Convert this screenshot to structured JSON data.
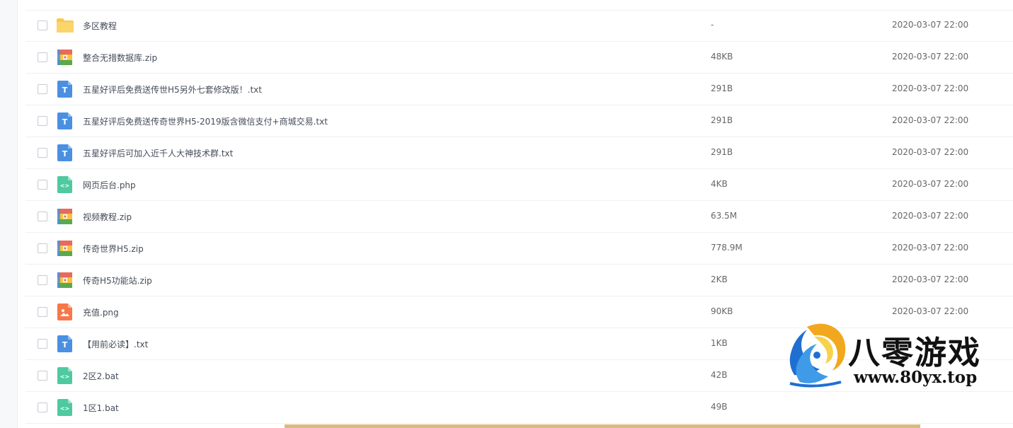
{
  "files": [
    {
      "name": "多区教程",
      "size": "-",
      "date": "2020-03-07 22:00",
      "type": "folder",
      "icon": "folder-icon"
    },
    {
      "name": "整合无措数据库.zip",
      "size": "48KB",
      "date": "2020-03-07 22:00",
      "type": "zip",
      "icon": "zip-icon"
    },
    {
      "name": "五星好评后免费送传世H5另外七套修改版！.txt",
      "size": "291B",
      "date": "2020-03-07 22:00",
      "type": "txt",
      "icon": "text-file-icon"
    },
    {
      "name": "五星好评后免费送传奇世界H5-2019版含微信支付+商城交易.txt",
      "size": "291B",
      "date": "2020-03-07 22:00",
      "type": "txt",
      "icon": "text-file-icon"
    },
    {
      "name": "五星好评后可加入近千人大神技术群.txt",
      "size": "291B",
      "date": "2020-03-07 22:00",
      "type": "txt",
      "icon": "text-file-icon"
    },
    {
      "name": "网页后台.php",
      "size": "4KB",
      "date": "2020-03-07 22:00",
      "type": "code",
      "icon": "code-file-icon"
    },
    {
      "name": "视频教程.zip",
      "size": "63.5M",
      "date": "2020-03-07 22:00",
      "type": "zip",
      "icon": "zip-icon"
    },
    {
      "name": "传奇世界H5.zip",
      "size": "778.9M",
      "date": "2020-03-07 22:00",
      "type": "zip",
      "icon": "zip-icon"
    },
    {
      "name": "传奇H5功能站.zip",
      "size": "2KB",
      "date": "2020-03-07 22:00",
      "type": "zip",
      "icon": "zip-icon"
    },
    {
      "name": "充值.png",
      "size": "90KB",
      "date": "2020-03-07 22:00",
      "type": "image",
      "icon": "image-file-icon"
    },
    {
      "name": "【用前必读】.txt",
      "size": "1KB",
      "date": "",
      "type": "txt",
      "icon": "text-file-icon"
    },
    {
      "name": "2区2.bat",
      "size": "42B",
      "date": "",
      "type": "code",
      "icon": "code-file-icon"
    },
    {
      "name": "1区1.bat",
      "size": "49B",
      "date": "",
      "type": "code",
      "icon": "code-file-icon"
    }
  ],
  "watermark": {
    "title": "八零游戏",
    "url": "www.80yx.top"
  },
  "colors": {
    "folder": "#f9c74f",
    "txt": "#4a90e2",
    "code": "#4ec9a0",
    "image": "#f7774a",
    "zip_top": "#e86a5b",
    "zip_mid": "#f5c440",
    "zip_bottom": "#5aaa4c",
    "zip_side": "#4a90e2",
    "accent_bar": "#d9bb82"
  }
}
